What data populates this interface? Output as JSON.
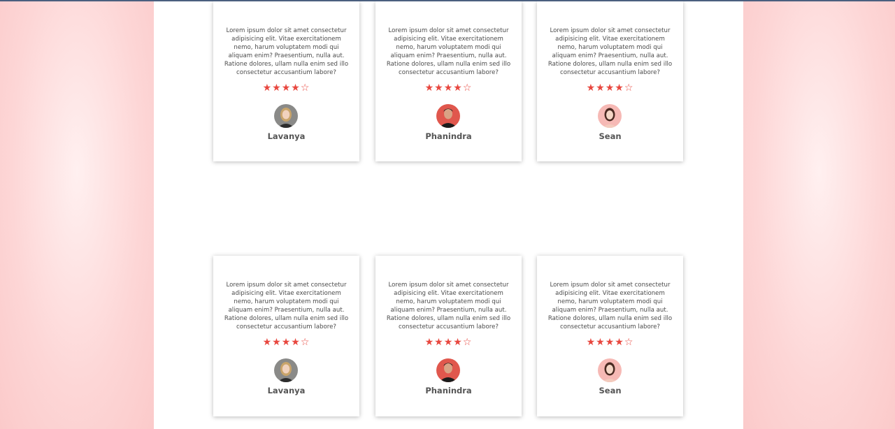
{
  "colors": {
    "star": "#e8473f",
    "accent_line": "#4a5f7f",
    "text": "#4b4b4b",
    "name": "#555555"
  },
  "rows": [
    {
      "cards": [
        {
          "quote": "Lorem ipsum dolor sit amet consectetur adipisicing elit. Vitae exercitationem nemo, harum voluptatem modi qui aliquam enim? Praesentium, nulla aut. Ratione dolores, ullam nulla enim sed illo consectetur accusantium labore?",
          "rating": "4 of 5",
          "stars": "★★★★☆",
          "avatar_icon": "woman-blonde-avatar-icon",
          "name": "Lavanya"
        },
        {
          "quote": "Lorem ipsum dolor sit amet consectetur adipisicing elit. Vitae exercitationem nemo, harum voluptatem modi qui aliquam enim? Praesentium, nulla aut. Ratione dolores, ullam nulla enim sed illo consectetur accusantium labore?",
          "rating": "4 of 5",
          "stars": "★★★★☆",
          "avatar_icon": "man-dark-hair-avatar-icon",
          "name": "Phanindra"
        },
        {
          "quote": "Lorem ipsum dolor sit amet consectetur adipisicing elit. Vitae exercitationem nemo, harum voluptatem modi qui aliquam enim? Praesentium, nulla aut. Ratione dolores, ullam nulla enim sed illo consectetur accusantium labore?",
          "rating": "4 of 5",
          "stars": "★★★★☆",
          "avatar_icon": "woman-pink-background-avatar-icon",
          "name": "Sean"
        }
      ]
    },
    {
      "cards": [
        {
          "quote": "Lorem ipsum dolor sit amet consectetur adipisicing elit. Vitae exercitationem nemo, harum voluptatem modi qui aliquam enim? Praesentium, nulla aut. Ratione dolores, ullam nulla enim sed illo consectetur accusantium labore?",
          "rating": "4 of 5",
          "stars": "★★★★☆",
          "avatar_icon": "woman-blonde-avatar-icon",
          "name": "Lavanya"
        },
        {
          "quote": "Lorem ipsum dolor sit amet consectetur adipisicing elit. Vitae exercitationem nemo, harum voluptatem modi qui aliquam enim? Praesentium, nulla aut. Ratione dolores, ullam nulla enim sed illo consectetur accusantium labore?",
          "rating": "4 of 5",
          "stars": "★★★★☆",
          "avatar_icon": "man-dark-hair-avatar-icon",
          "name": "Phanindra"
        },
        {
          "quote": "Lorem ipsum dolor sit amet consectetur adipisicing elit. Vitae exercitationem nemo, harum voluptatem modi qui aliquam enim? Praesentium, nulla aut. Ratione dolores, ullam nulla enim sed illo consectetur accusantium labore?",
          "rating": "4 of 5",
          "stars": "★★★★☆",
          "avatar_icon": "woman-pink-background-avatar-icon",
          "name": "Sean"
        }
      ]
    }
  ]
}
